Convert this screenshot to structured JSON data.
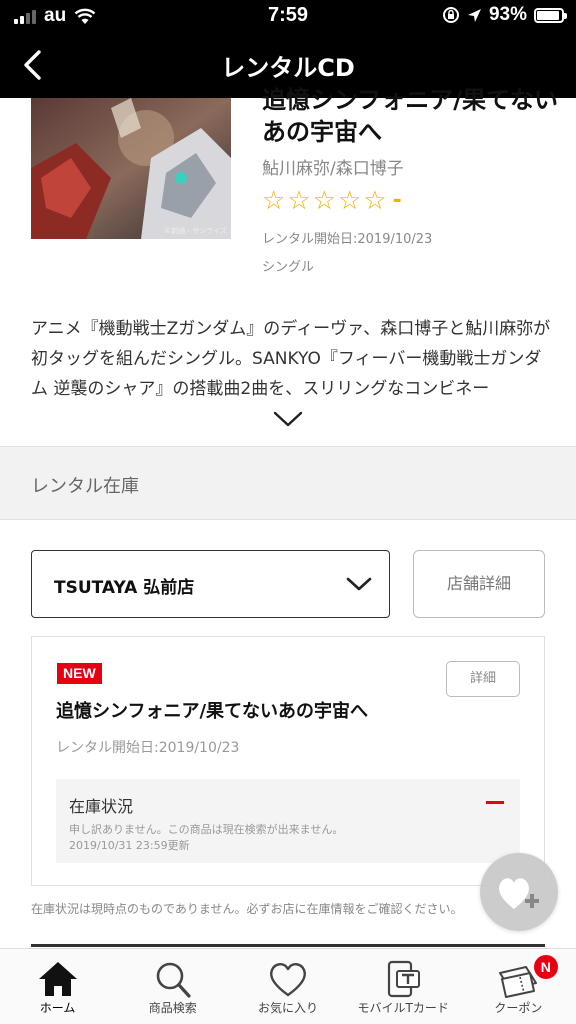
{
  "status_bar": {
    "carrier": "au",
    "time": "7:59",
    "battery_percent": "93%",
    "battery_level": 0.93,
    "icons": [
      "signal-icon",
      "wifi-icon",
      "rotation-lock-icon",
      "location-icon",
      "battery-icon"
    ]
  },
  "nav": {
    "title": "レンタルCD",
    "back_icon": "chevron-left-icon"
  },
  "product": {
    "title": "追憶シンフォニア/果てないあの宇宙へ",
    "artist": "鮎川麻弥/森口博子",
    "rating_stars": 5,
    "rating_filled": 0,
    "rating_value": "-",
    "rental_start": "レンタル開始日:2019/10/23",
    "format": "シングル",
    "jacket_credit": "©創通・サンライズ",
    "description": "アニメ『機動戦士Zガンダム』のディーヴァ、森口博子と鮎川麻弥が初タッグを組んだシングル。SANKYO『フィーバー機動戦士ガンダム 逆襲のシャア』の搭載曲2曲を、スリリングなコンビネー"
  },
  "stock_section": {
    "header": "レンタル在庫",
    "store_name": "TSUTAYA 弘前店",
    "store_detail_label": "店舗詳細",
    "card": {
      "badge": "NEW",
      "detail_label": "詳細",
      "title": "追憶シンフォニア/果てないあの宇宙へ",
      "rental_start": "レンタル開始日:2019/10/23",
      "stock_label": "在庫状況",
      "stock_message": "申し訳ありません。この商品は現在検索が出来ません。",
      "updated": "2019/10/31 23:59更新"
    },
    "notice": "在庫状況は現時点のものでありません。必ずお店に在庫情報をご確認ください。"
  },
  "colors": {
    "accent_red": "#e60012",
    "star_yellow": "#f0b400",
    "header_bg": "#000000"
  },
  "tabs": [
    {
      "label": "ホーム",
      "icon": "home-icon",
      "active": true
    },
    {
      "label": "商品検索",
      "icon": "search-icon",
      "active": false
    },
    {
      "label": "お気に入り",
      "icon": "heart-icon",
      "active": false
    },
    {
      "label": "モバイルTカード",
      "icon": "tcard-icon",
      "active": false
    },
    {
      "label": "クーポン",
      "icon": "coupon-icon",
      "active": false,
      "badge": "N"
    }
  ]
}
